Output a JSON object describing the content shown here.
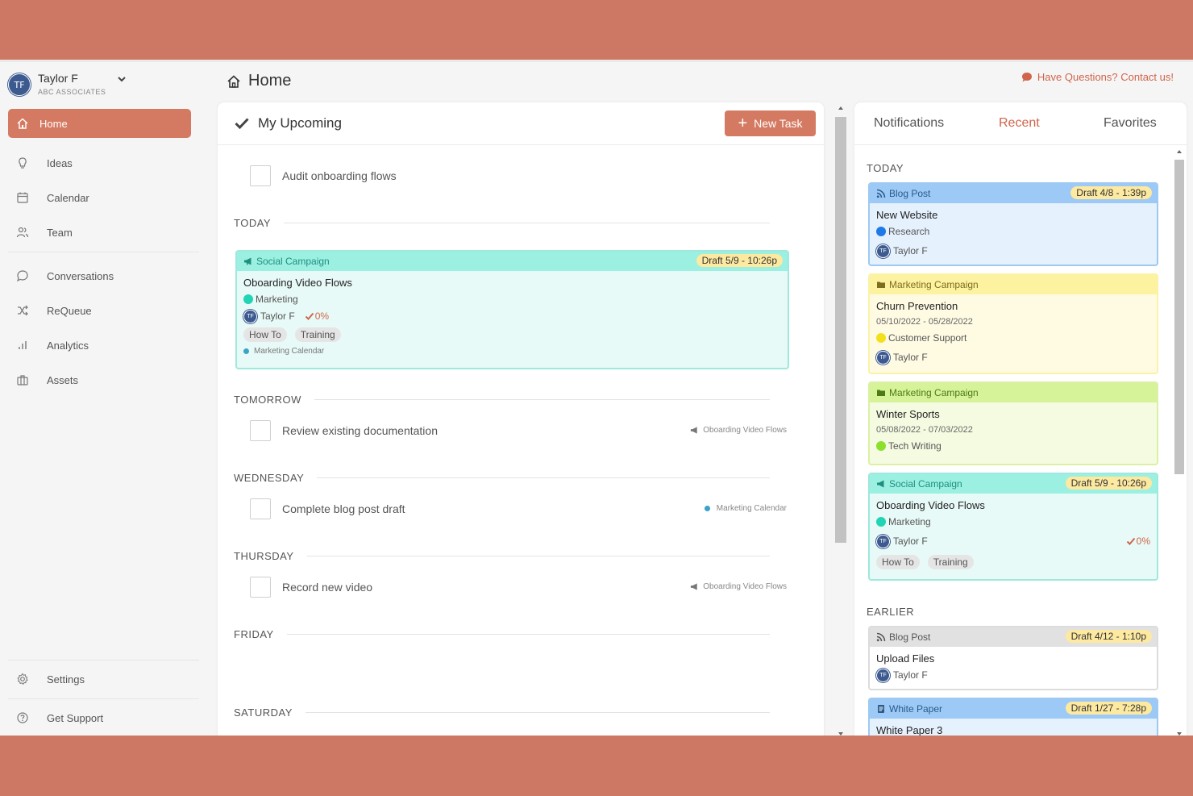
{
  "user": {
    "initials": "TF",
    "name": "Taylor F",
    "org": "ABC ASSOCIATES"
  },
  "nav": {
    "items": [
      {
        "label": "Home",
        "icon": "home-icon"
      },
      {
        "label": "Ideas",
        "icon": "lightbulb-icon"
      },
      {
        "label": "Calendar",
        "icon": "calendar-icon"
      },
      {
        "label": "Team",
        "icon": "team-icon"
      },
      {
        "label": "Conversations",
        "icon": "chat-icon"
      },
      {
        "label": "ReQueue",
        "icon": "shuffle-icon"
      },
      {
        "label": "Analytics",
        "icon": "bar-chart-icon"
      },
      {
        "label": "Assets",
        "icon": "briefcase-icon"
      }
    ],
    "bottom": [
      {
        "label": "Settings",
        "icon": "gear-icon"
      },
      {
        "label": "Get Support",
        "icon": "help-icon"
      }
    ]
  },
  "header": {
    "title": "Home",
    "contact": "Have Questions? Contact us!"
  },
  "upcoming": {
    "title": "My Upcoming",
    "new_task": "New Task",
    "undated_task": "Audit onboarding flows",
    "sections": [
      "TODAY",
      "TOMORROW",
      "WEDNESDAY",
      "THURSDAY",
      "FRIDAY",
      "SATURDAY"
    ],
    "today_card": {
      "type": "Social Campaign",
      "badge": "Draft 5/9 - 10:26p",
      "title": "Oboarding Video Flows",
      "category": "Marketing",
      "owner": "Taylor F",
      "progress": "0%",
      "tags": [
        "How To",
        "Training"
      ],
      "calendar": "Marketing Calendar"
    },
    "tasks": [
      {
        "label": "Review existing documentation",
        "ref": "Oboarding Video Flows"
      },
      {
        "label": "Complete blog post draft",
        "ref": "Marketing Calendar"
      },
      {
        "label": "Record new video",
        "ref": "Oboarding Video Flows"
      }
    ]
  },
  "right": {
    "tabs": [
      "Notifications",
      "Recent",
      "Favorites"
    ],
    "active_tab": "Recent",
    "today_label": "TODAY",
    "earlier_label": "EARLIER",
    "cards": [
      {
        "type": "Blog Post",
        "badge": "Draft 4/8 - 1:39p",
        "title": "New Website",
        "category": "Research",
        "owner": "Taylor F"
      },
      {
        "type": "Marketing Campaign",
        "title": "Churn Prevention",
        "dates": "05/10/2022 - 05/28/2022",
        "category": "Customer Support",
        "owner": "Taylor F"
      },
      {
        "type": "Marketing Campaign",
        "title": "Winter Sports",
        "dates": "05/08/2022 - 07/03/2022",
        "category": "Tech Writing"
      },
      {
        "type": "Social Campaign",
        "badge": "Draft 5/9 - 10:26p",
        "title": "Oboarding Video Flows",
        "category": "Marketing",
        "owner": "Taylor F",
        "progress": "0%",
        "tags": [
          "How To",
          "Training"
        ]
      },
      {
        "type": "Blog Post",
        "badge": "Draft 4/12 - 1:10p",
        "title": "Upload Files",
        "owner": "Taylor F"
      },
      {
        "type": "White Paper",
        "badge": "Draft 1/27 - 7:28p",
        "title": "White Paper 3"
      }
    ]
  },
  "colors": {
    "accent": "#d57a62",
    "avatar": "#3c5a8f",
    "frame": "#cd7864"
  }
}
